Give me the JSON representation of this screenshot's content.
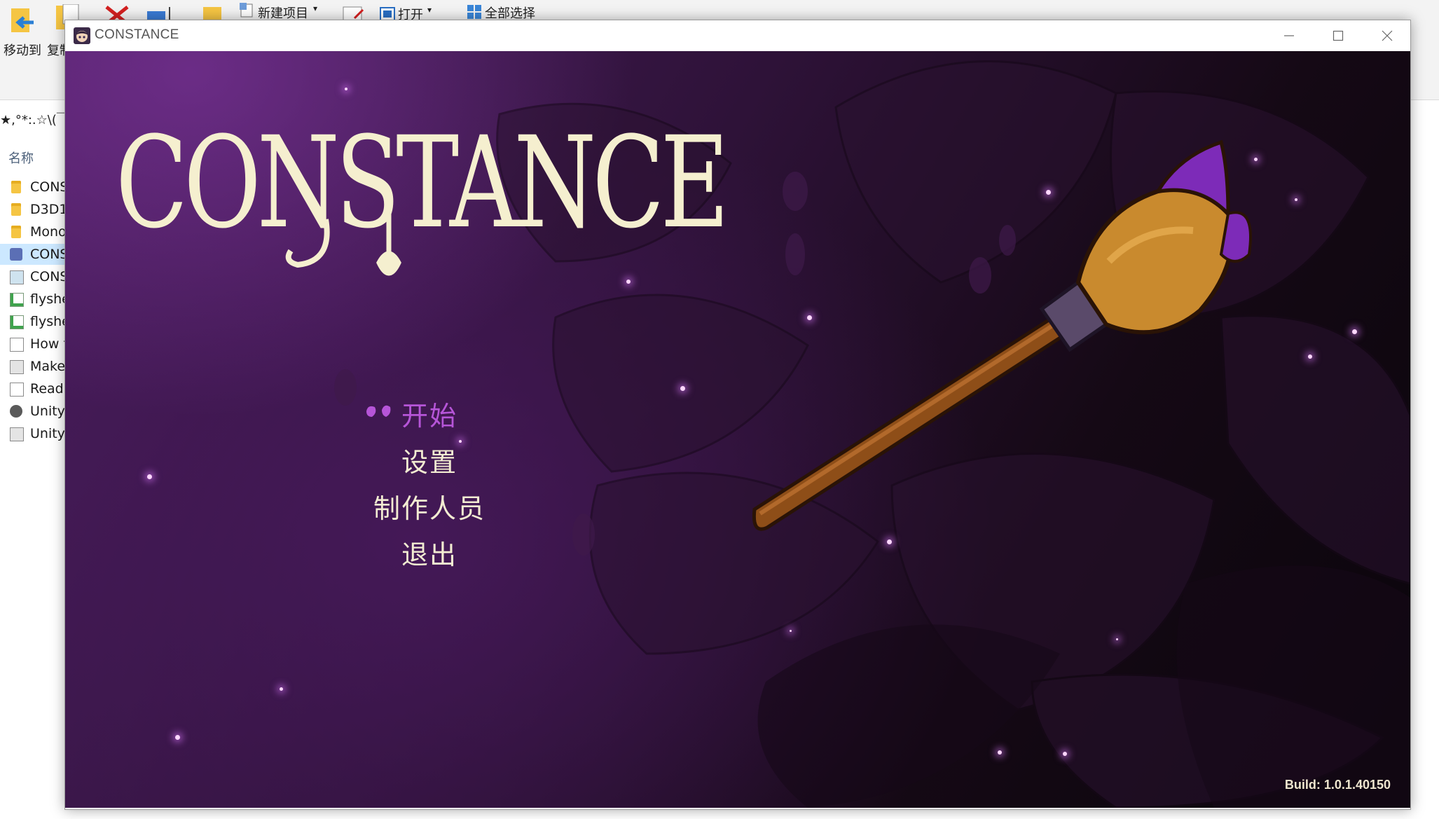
{
  "explorer": {
    "ribbon": {
      "move_to": "移动到",
      "copy_to": "复制",
      "new_item": "新建项目",
      "open": "打开",
      "select_all": "全部选择"
    },
    "address_fragment": "★,°*:.☆\\(￣▽",
    "column_name": "名称",
    "files": [
      {
        "name": "CONS",
        "icon": "folder-icon"
      },
      {
        "name": "D3D1",
        "icon": "folder-icon"
      },
      {
        "name": "Mono",
        "icon": "folder-icon"
      },
      {
        "name": "CONS",
        "icon": "constance-app-icon",
        "selected": true
      },
      {
        "name": "CONS",
        "icon": "data-file-icon"
      },
      {
        "name": "flyshe",
        "icon": "config-file-icon"
      },
      {
        "name": "flyshe",
        "icon": "config-file-icon"
      },
      {
        "name": "How t",
        "icon": "text-file-icon"
      },
      {
        "name": "Make",
        "icon": "image-file-icon"
      },
      {
        "name": "ReadI",
        "icon": "text-file-icon"
      },
      {
        "name": "Unity",
        "icon": "unity-icon"
      },
      {
        "name": "Unity",
        "icon": "image-file-icon"
      }
    ]
  },
  "window": {
    "title": "CONSTANCE",
    "icon": "constance-app-icon"
  },
  "game": {
    "logo_text": "CONSTANCE",
    "menu": {
      "start": "开始",
      "settings": "设置",
      "credits": "制作人员",
      "quit": "退出",
      "selected": "start"
    },
    "build": "Build: 1.0.1.40150"
  },
  "colors": {
    "logo_cream": "#f5efcf",
    "menu_selected": "#b655d8",
    "menu_normal": "#f3ecd2",
    "brush_handle": "#a05a1f",
    "brush_bristles": "#c98a2e",
    "paint_purple": "#7d2bb8"
  }
}
